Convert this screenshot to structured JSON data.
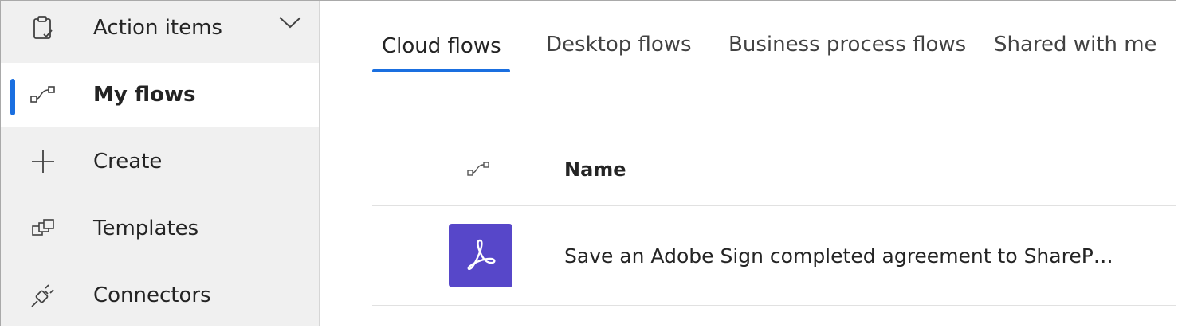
{
  "sidebar": {
    "items": [
      {
        "label": "Action items",
        "icon": "clipboard-check-icon",
        "expandable": true
      },
      {
        "label": "My flows",
        "icon": "flow-icon",
        "active": true
      },
      {
        "label": "Create",
        "icon": "plus-icon"
      },
      {
        "label": "Templates",
        "icon": "templates-icon"
      },
      {
        "label": "Connectors",
        "icon": "plug-icon"
      }
    ]
  },
  "tabs": [
    {
      "label": "Cloud flows",
      "active": true
    },
    {
      "label": "Desktop flows"
    },
    {
      "label": "Business process flows"
    },
    {
      "label": "Shared with me"
    }
  ],
  "table": {
    "header_icon": "flow-icon",
    "name_header": "Name",
    "rows": [
      {
        "name": "Save an Adobe Sign completed agreement to ShareP…",
        "icon": "adobe-sign-icon",
        "tile_color": "#5747c9"
      }
    ]
  },
  "colors": {
    "accent": "#1a6fe0",
    "sidebar_bg": "#f0f0f0"
  }
}
